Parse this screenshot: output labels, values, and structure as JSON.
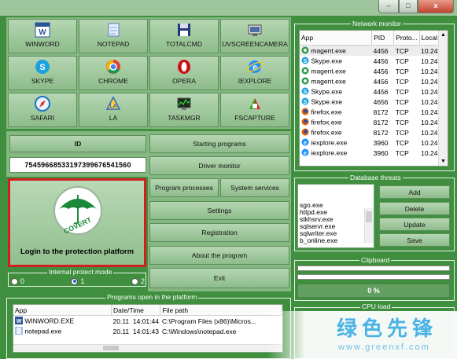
{
  "window": {
    "minimize": "–",
    "maximize": "□",
    "close": "x"
  },
  "apps": [
    {
      "label": "WINWORD",
      "icon": "word-icon"
    },
    {
      "label": "NOTEPAD",
      "icon": "notepad-icon"
    },
    {
      "label": "TOTALCMD",
      "icon": "floppy-icon"
    },
    {
      "label": "UVSCREENCAMERA",
      "icon": "camera-icon"
    },
    {
      "label": "SKYPE",
      "icon": "skype-icon"
    },
    {
      "label": "CHROME",
      "icon": "chrome-icon"
    },
    {
      "label": "OPERA",
      "icon": "opera-icon"
    },
    {
      "label": "IEXPLORE",
      "icon": "ie-icon"
    },
    {
      "label": "SAFARI",
      "icon": "safari-icon"
    },
    {
      "label": "LA",
      "icon": "la-icon"
    },
    {
      "label": "TASKMGR",
      "icon": "taskmgr-icon"
    },
    {
      "label": "FSCAPTURE",
      "icon": "fscapture-icon"
    }
  ],
  "id_label": "ID",
  "id_value": "75459668533197399676541560",
  "logo_text": "COVERT",
  "login_label": "Login to the protection platform",
  "internal_protect": {
    "title": "Internal protect mode",
    "options": [
      "0",
      "1",
      "2"
    ],
    "selected": "1"
  },
  "actions": {
    "starting_programs": "Starting programs",
    "driver_monitor": "Driver monitor",
    "program_processes": "Program processes",
    "system_services": "System services",
    "settings": "Settings",
    "registration": "Registration",
    "about": "About the program",
    "exit": "Exit"
  },
  "programs_open": {
    "title": "Programs open in the platform",
    "columns": [
      "App",
      "Date/Time",
      "File path"
    ],
    "rows": [
      {
        "app": "WINWORD.EXE",
        "date": "20.11",
        "time": "14:01:44",
        "path": "C:\\Program Files (x86)\\Micros..."
      },
      {
        "app": "notepad.exe",
        "date": "20.11",
        "time": "14:01:43",
        "path": "C:\\Windows\\notepad.exe"
      }
    ]
  },
  "network_monitor": {
    "title": "Network monitor",
    "columns": [
      "App",
      "PID",
      "Proto...",
      "Local"
    ],
    "rows": [
      {
        "app": "magent.exe",
        "pid": "4456",
        "proto": "TCP",
        "local": "10.24",
        "icon": "magent-icon"
      },
      {
        "app": "Skype.exe",
        "pid": "4456",
        "proto": "TCP",
        "local": "10.24",
        "icon": "skype-icon"
      },
      {
        "app": "magent.exe",
        "pid": "4456",
        "proto": "TCP",
        "local": "10.24",
        "icon": "magent-icon"
      },
      {
        "app": "magent.exe",
        "pid": "4456",
        "proto": "TCP",
        "local": "10.24",
        "icon": "magent-icon"
      },
      {
        "app": "Skype.exe",
        "pid": "4456",
        "proto": "TCP",
        "local": "10.24",
        "icon": "skype-icon"
      },
      {
        "app": "Skype.exe",
        "pid": "4656",
        "proto": "TCP",
        "local": "10.24",
        "icon": "skype-icon"
      },
      {
        "app": "firefox.exe",
        "pid": "8172",
        "proto": "TCP",
        "local": "10.24",
        "icon": "firefox-icon"
      },
      {
        "app": "firefox.exe",
        "pid": "8172",
        "proto": "TCP",
        "local": "10.24",
        "icon": "firefox-icon"
      },
      {
        "app": "firefox.exe",
        "pid": "8172",
        "proto": "TCP",
        "local": "10.24",
        "icon": "firefox-icon"
      },
      {
        "app": "iexplore.exe",
        "pid": "3960",
        "proto": "TCP",
        "local": "10.24",
        "icon": "ie-icon"
      },
      {
        "app": "iexplore.exe",
        "pid": "3960",
        "proto": "TCP",
        "local": "10.24",
        "icon": "ie-icon"
      }
    ]
  },
  "database_threats": {
    "title": "Database threats",
    "items": [
      "sgo.exe",
      "httpd.exe",
      "stkhsrv.exe",
      "sqlservr.exe",
      "sqlwriter.exe",
      "b_online.exe"
    ],
    "buttons": {
      "add": "Add",
      "delete": "Delete",
      "update": "Update",
      "save": "Save"
    }
  },
  "clipboard": {
    "title": "Clipboard",
    "progress_text": "0 %",
    "progress": 0
  },
  "cpu_load": {
    "title": "CPU load"
  },
  "watermark": {
    "text": "绿色先锋",
    "url": "www.greenxf.com"
  }
}
